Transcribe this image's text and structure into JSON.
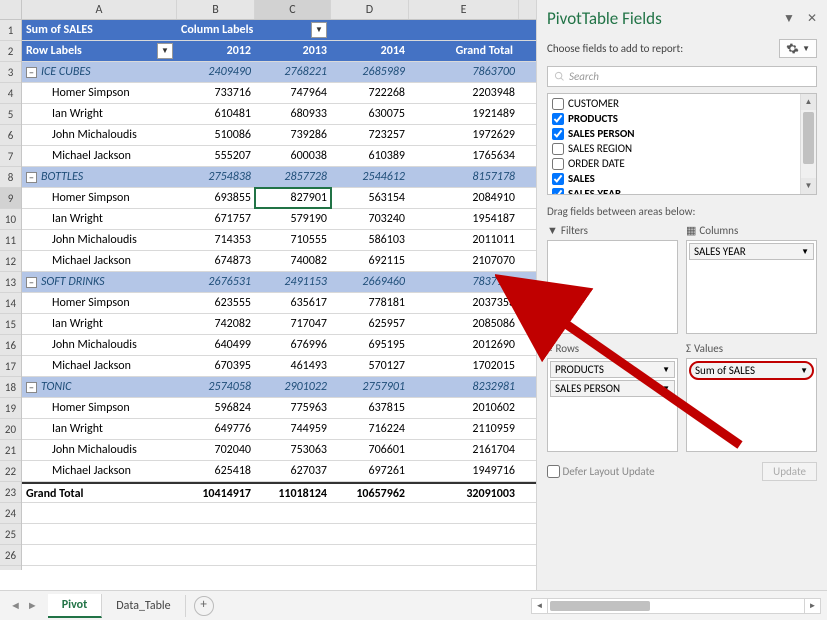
{
  "cols": [
    "A",
    "B",
    "C",
    "D",
    "E"
  ],
  "header": {
    "title": "Sum of SALES",
    "colLabels": "Column Labels",
    "rowLabels": "Row Labels",
    "y1": "2012",
    "y2": "2013",
    "y3": "2014",
    "gt": "Grand Total"
  },
  "rows": [
    {
      "n": 3,
      "type": "grp",
      "a": "ICE CUBES",
      "b": "2409490",
      "c": "2768221",
      "d": "2685989",
      "e": "7863700"
    },
    {
      "n": 4,
      "type": "leaf",
      "a": "Homer Simpson",
      "b": "733716",
      "c": "747964",
      "d": "722268",
      "e": "2203948"
    },
    {
      "n": 5,
      "type": "leaf",
      "a": "Ian Wright",
      "b": "610481",
      "c": "680933",
      "d": "630075",
      "e": "1921489"
    },
    {
      "n": 6,
      "type": "leaf",
      "a": "John Michaloudis",
      "b": "510086",
      "c": "739286",
      "d": "723257",
      "e": "1972629"
    },
    {
      "n": 7,
      "type": "leaf",
      "a": "Michael Jackson",
      "b": "555207",
      "c": "600038",
      "d": "610389",
      "e": "1765634"
    },
    {
      "n": 8,
      "type": "grp",
      "a": "BOTTLES",
      "b": "2754838",
      "c": "2857728",
      "d": "2544612",
      "e": "8157178"
    },
    {
      "n": 9,
      "type": "leaf",
      "a": "Homer Simpson",
      "b": "693855",
      "c": "827901",
      "d": "563154",
      "e": "2084910",
      "sel": true
    },
    {
      "n": 10,
      "type": "leaf",
      "a": "Ian Wright",
      "b": "671757",
      "c": "579190",
      "d": "703240",
      "e": "1954187"
    },
    {
      "n": 11,
      "type": "leaf",
      "a": "John Michaloudis",
      "b": "714353",
      "c": "710555",
      "d": "586103",
      "e": "2011011"
    },
    {
      "n": 12,
      "type": "leaf",
      "a": "Michael Jackson",
      "b": "674873",
      "c": "740082",
      "d": "692115",
      "e": "2107070"
    },
    {
      "n": 13,
      "type": "grp",
      "a": "SOFT DRINKS",
      "b": "2676531",
      "c": "2491153",
      "d": "2669460",
      "e": "7837144"
    },
    {
      "n": 14,
      "type": "leaf",
      "a": "Homer Simpson",
      "b": "623555",
      "c": "635617",
      "d": "778181",
      "e": "2037353"
    },
    {
      "n": 15,
      "type": "leaf",
      "a": "Ian Wright",
      "b": "742082",
      "c": "717047",
      "d": "625957",
      "e": "2085086"
    },
    {
      "n": 16,
      "type": "leaf",
      "a": "John Michaloudis",
      "b": "640499",
      "c": "676996",
      "d": "695195",
      "e": "2012690"
    },
    {
      "n": 17,
      "type": "leaf",
      "a": "Michael Jackson",
      "b": "670395",
      "c": "461493",
      "d": "570127",
      "e": "1702015"
    },
    {
      "n": 18,
      "type": "grp",
      "a": "TONIC",
      "b": "2574058",
      "c": "2901022",
      "d": "2757901",
      "e": "8232981"
    },
    {
      "n": 19,
      "type": "leaf",
      "a": "Homer Simpson",
      "b": "596824",
      "c": "775963",
      "d": "637815",
      "e": "2010602"
    },
    {
      "n": 20,
      "type": "leaf",
      "a": "Ian Wright",
      "b": "649776",
      "c": "744959",
      "d": "716224",
      "e": "2110959"
    },
    {
      "n": 21,
      "type": "leaf",
      "a": "John Michaloudis",
      "b": "702040",
      "c": "753063",
      "d": "706601",
      "e": "2161704"
    },
    {
      "n": 22,
      "type": "leaf",
      "a": "Michael Jackson",
      "b": "625418",
      "c": "627037",
      "d": "697261",
      "e": "1949716"
    },
    {
      "n": 23,
      "type": "gt",
      "a": "Grand Total",
      "b": "10414917",
      "c": "11018124",
      "d": "10657962",
      "e": "32091003"
    }
  ],
  "panel": {
    "title": "PivotTable Fields",
    "sub": "Choose fields to add to report:",
    "search": "Search",
    "fields": [
      {
        "label": "CUSTOMER",
        "checked": false
      },
      {
        "label": "PRODUCTS",
        "checked": true
      },
      {
        "label": "SALES PERSON",
        "checked": true
      },
      {
        "label": "SALES REGION",
        "checked": false
      },
      {
        "label": "ORDER DATE",
        "checked": false
      },
      {
        "label": "SALES",
        "checked": true
      },
      {
        "label": "SALES YEAR",
        "checked": true
      }
    ],
    "drag": "Drag fields between areas below:",
    "filters": "Filters",
    "columns": "Columns",
    "rowsLabel": "Rows",
    "values": "Values",
    "colChip": "SALES YEAR",
    "rowChip1": "PRODUCTS",
    "rowChip2": "SALES PERSON",
    "valChip": "Sum of SALES",
    "defer": "Defer Layout Update",
    "update": "Update"
  },
  "tabs": {
    "t1": "Pivot",
    "t2": "Data_Table"
  },
  "chart_data": {
    "type": "table",
    "title": "Sum of SALES",
    "columns": [
      "2012",
      "2013",
      "2014",
      "Grand Total"
    ],
    "rows": [
      {
        "label": "ICE CUBES",
        "values": [
          2409490,
          2768221,
          2685989,
          7863700
        ],
        "children": [
          {
            "label": "Homer Simpson",
            "values": [
              733716,
              747964,
              722268,
              2203948
            ]
          },
          {
            "label": "Ian Wright",
            "values": [
              610481,
              680933,
              630075,
              1921489
            ]
          },
          {
            "label": "John Michaloudis",
            "values": [
              510086,
              739286,
              723257,
              1972629
            ]
          },
          {
            "label": "Michael Jackson",
            "values": [
              555207,
              600038,
              610389,
              1765634
            ]
          }
        ]
      },
      {
        "label": "BOTTLES",
        "values": [
          2754838,
          2857728,
          2544612,
          8157178
        ],
        "children": [
          {
            "label": "Homer Simpson",
            "values": [
              693855,
              827901,
              563154,
              2084910
            ]
          },
          {
            "label": "Ian Wright",
            "values": [
              671757,
              579190,
              703240,
              1954187
            ]
          },
          {
            "label": "John Michaloudis",
            "values": [
              714353,
              710555,
              586103,
              2011011
            ]
          },
          {
            "label": "Michael Jackson",
            "values": [
              674873,
              740082,
              692115,
              2107070
            ]
          }
        ]
      },
      {
        "label": "SOFT DRINKS",
        "values": [
          2676531,
          2491153,
          2669460,
          7837144
        ],
        "children": [
          {
            "label": "Homer Simpson",
            "values": [
              623555,
              635617,
              778181,
              2037353
            ]
          },
          {
            "label": "Ian Wright",
            "values": [
              742082,
              717047,
              625957,
              2085086
            ]
          },
          {
            "label": "John Michaloudis",
            "values": [
              640499,
              676996,
              695195,
              2012690
            ]
          },
          {
            "label": "Michael Jackson",
            "values": [
              670395,
              461493,
              570127,
              1702015
            ]
          }
        ]
      },
      {
        "label": "TONIC",
        "values": [
          2574058,
          2901022,
          2757901,
          8232981
        ],
        "children": [
          {
            "label": "Homer Simpson",
            "values": [
              596824,
              775963,
              637815,
              2010602
            ]
          },
          {
            "label": "Ian Wright",
            "values": [
              649776,
              744959,
              716224,
              2110959
            ]
          },
          {
            "label": "John Michaloudis",
            "values": [
              702040,
              753063,
              706601,
              2161704
            ]
          },
          {
            "label": "Michael Jackson",
            "values": [
              625418,
              627037,
              697261,
              1949716
            ]
          }
        ]
      }
    ],
    "grand_total": [
      10414917,
      11018124,
      10657962,
      32091003
    ]
  }
}
